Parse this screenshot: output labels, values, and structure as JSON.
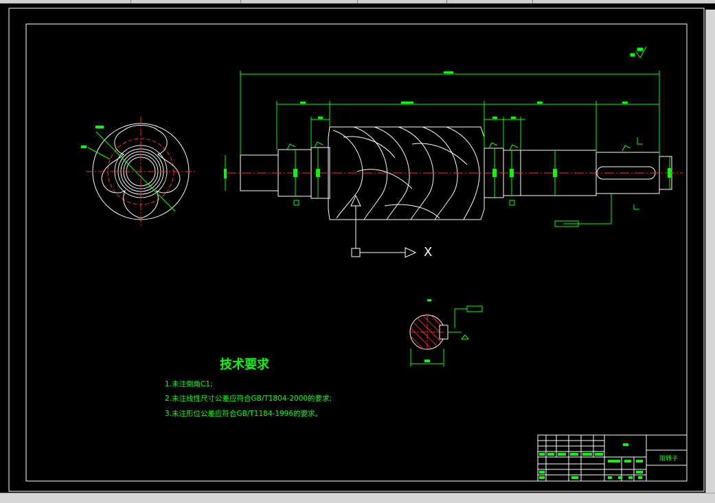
{
  "drawing": {
    "tech_title": "技术要求",
    "notes": [
      "1.未注倒角C1;",
      "2.未注线性尺寸公差应符合GB/T1804-2000的要求;",
      "3.未注形位公差应符合GB/T1184-1996的要求。"
    ],
    "ucs_axis_label": "X",
    "title_block": {
      "part_name": "阳转子"
    }
  },
  "colors": {
    "background": "#000000",
    "outline": "#ffffff",
    "dimension": "#00ff00",
    "centerline": "#ff2a2a",
    "chrome": "#d6d6d6"
  }
}
